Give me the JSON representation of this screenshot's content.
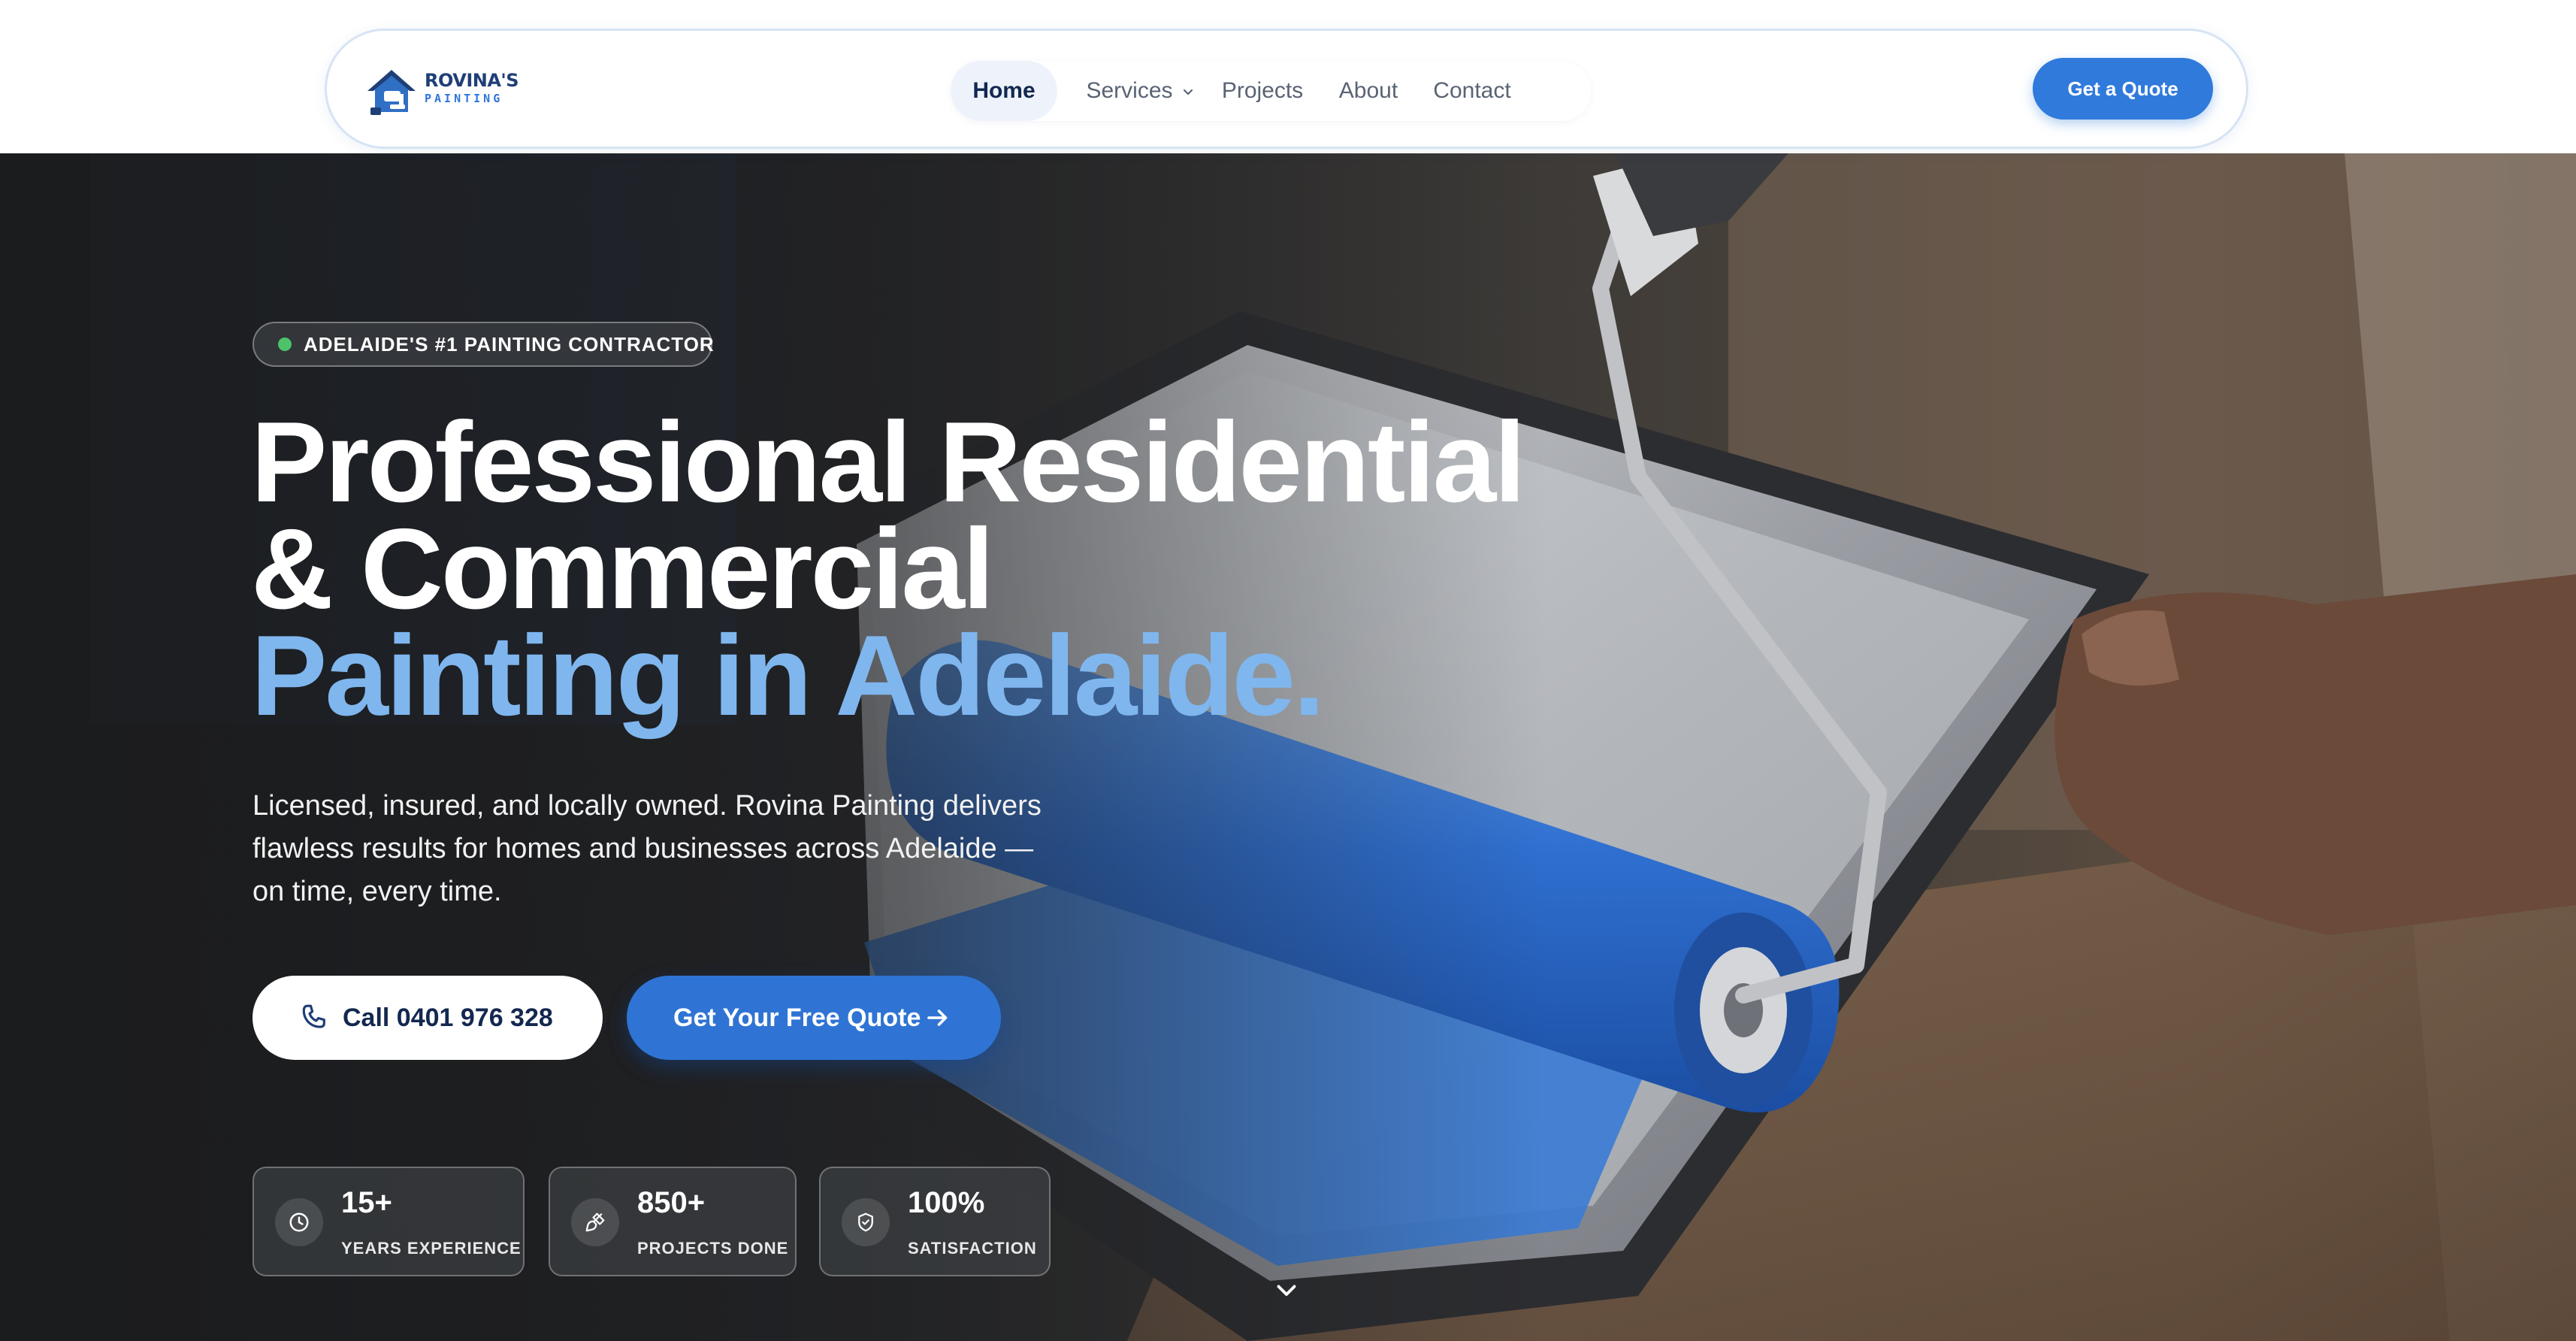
{
  "brand": {
    "logo_title": "ROVINA'S",
    "logo_subtitle": "PAINTING",
    "logo_icon": "house-paint-roller-icon"
  },
  "nav": {
    "items": [
      {
        "label": "Home",
        "active": true
      },
      {
        "label": "Services",
        "has_dropdown": true
      },
      {
        "label": "Projects"
      },
      {
        "label": "About"
      },
      {
        "label": "Contact"
      }
    ],
    "cta_label": "Get a Quote"
  },
  "hero": {
    "badge": "ADELAIDE'S #1 PAINTING CONTRACTOR",
    "headline_line1": "Professional Residential",
    "headline_line2": "& Commercial",
    "headline_line3": "Painting in Adelaide.",
    "lead": "Licensed, insured, and locally owned. Rovina Painting delivers flawless results for homes and businesses across Adelaide — on time, every time.",
    "call_button": "Call 0401 976 328",
    "quote_button": "Get Your Free Quote",
    "background": "blue-paint-roller-in-tray-photo"
  },
  "stats": [
    {
      "value": "15+",
      "label": "YEARS EXPERIENCE",
      "icon": "clock-icon"
    },
    {
      "value": "850+",
      "label": "PROJECTS DONE",
      "icon": "paintbrush-icon"
    },
    {
      "value": "100%",
      "label": "SATISFACTION",
      "icon": "shield-check-icon"
    }
  ],
  "colors": {
    "accent": "#2F7ADB",
    "headline_accent": "#7FB6EE",
    "brand_navy": "#1F3F77",
    "badge_dot": "#4CC26B"
  }
}
